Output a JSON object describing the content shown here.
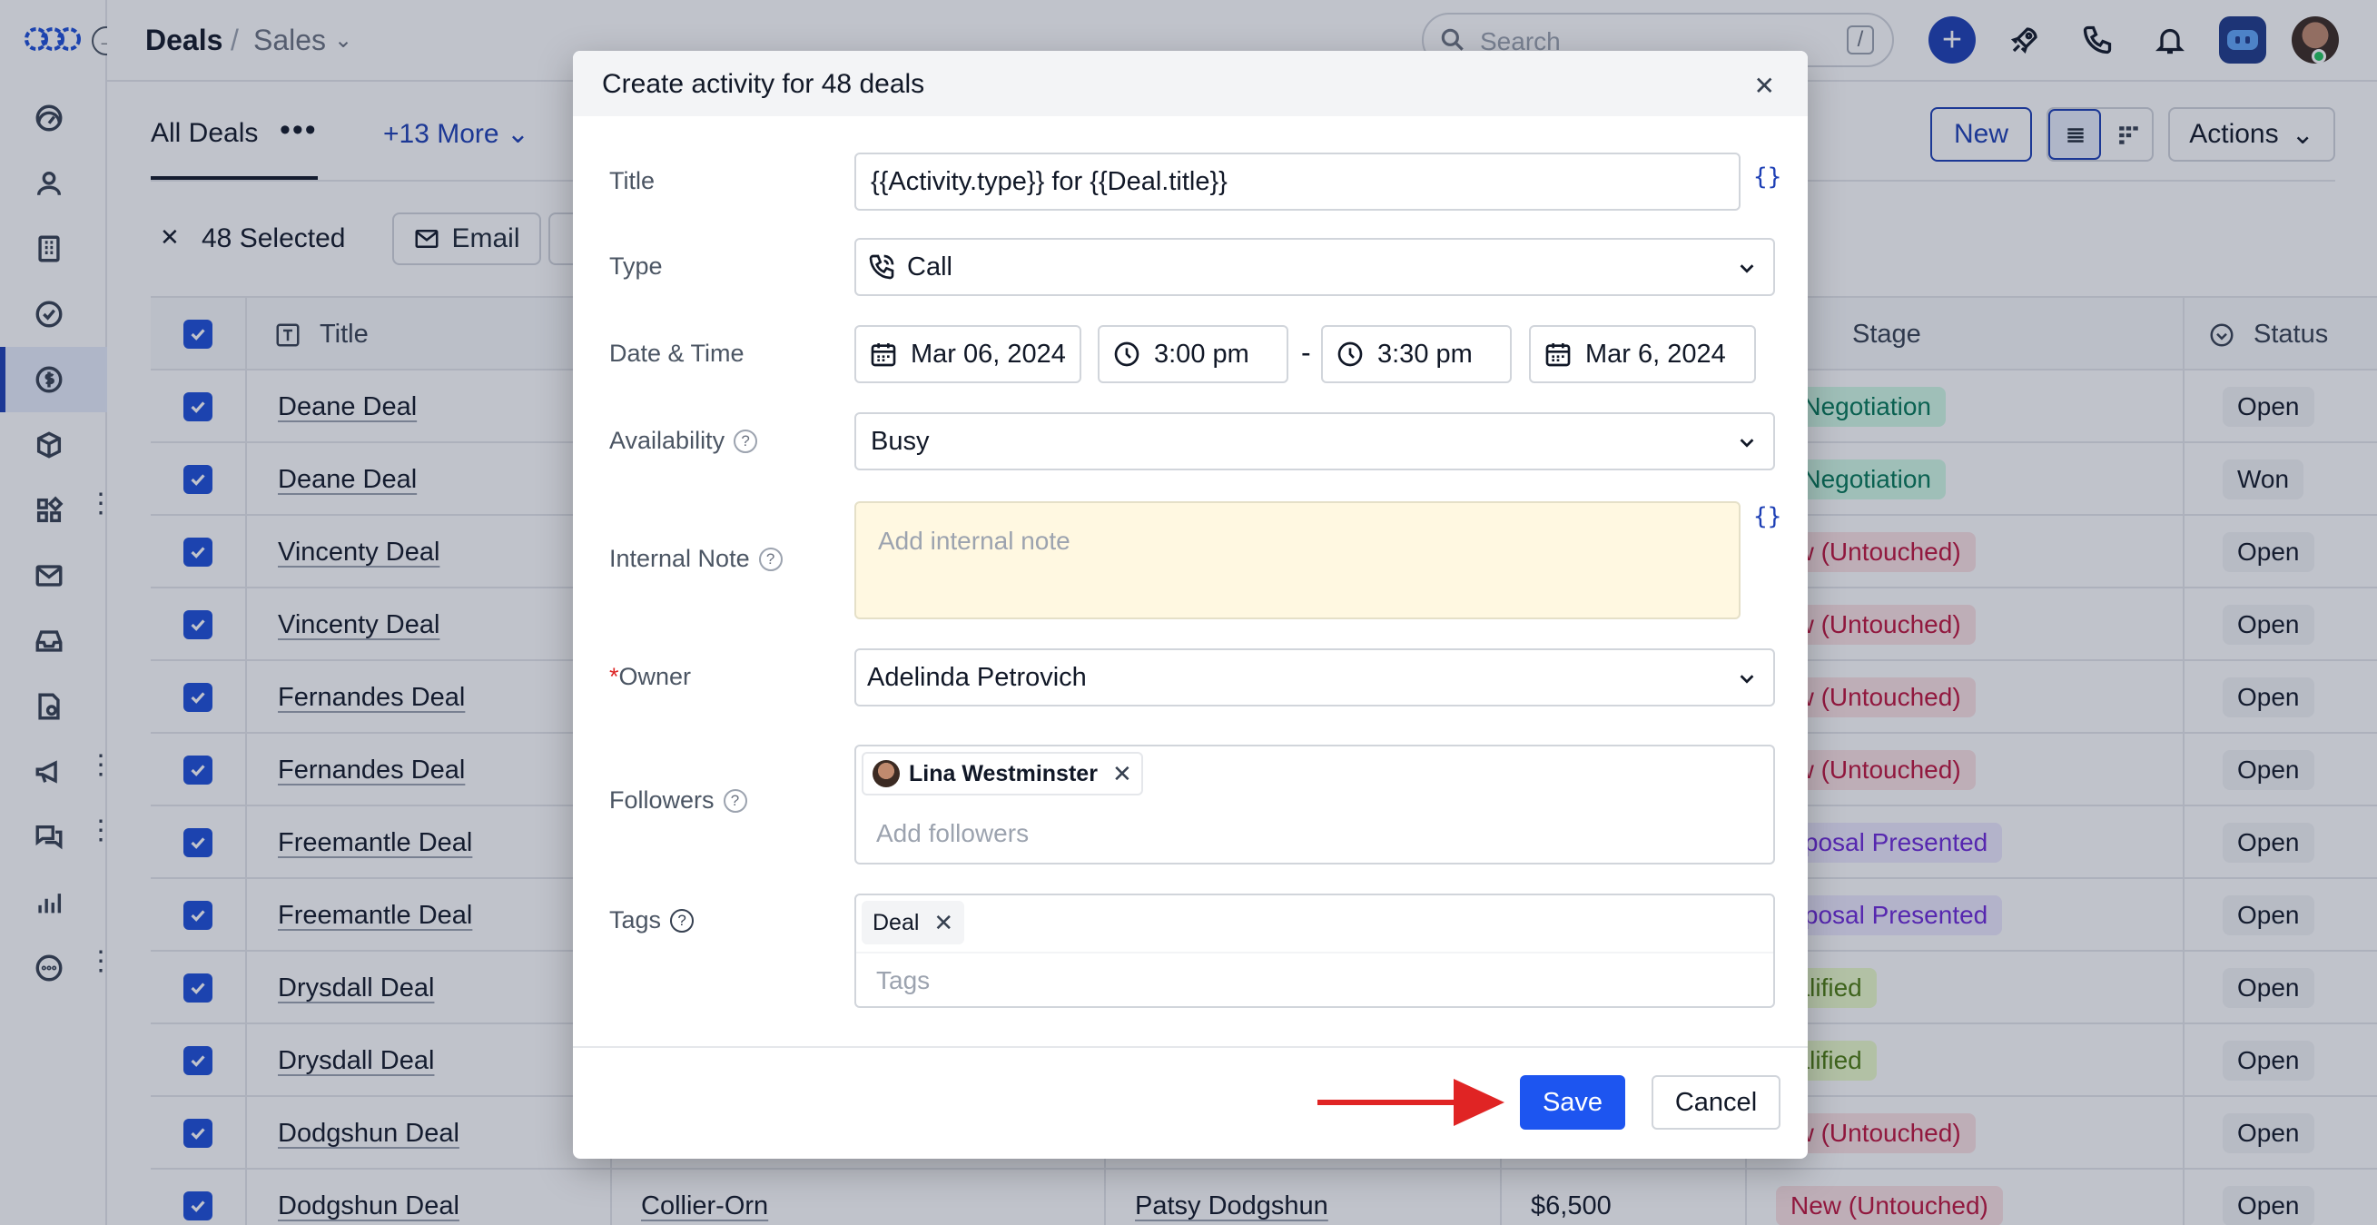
{
  "app": {
    "breadcrumb": {
      "root": "Deals",
      "separator": "/",
      "view": "Sales"
    },
    "search": {
      "placeholder": "Search",
      "shortcut": "/"
    },
    "tabs": {
      "active": "All Deals",
      "more": "+13 More"
    },
    "toolbar": {
      "new_label": "New",
      "actions_label": "Actions"
    },
    "selection": {
      "count_label": "48 Selected",
      "email_label": "Email"
    },
    "table": {
      "headers": {
        "title": "Title",
        "stage": "Stage",
        "status": "Status"
      },
      "rows": [
        {
          "title": "Deane Deal",
          "stage": "n Negotiation",
          "stage_color": "green",
          "status": "Open"
        },
        {
          "title": "Deane Deal",
          "stage": "n Negotiation",
          "stage_color": "green",
          "status": "Won"
        },
        {
          "title": "Vincenty Deal",
          "stage": "ew (Untouched)",
          "stage_color": "red",
          "status": "Open"
        },
        {
          "title": "Vincenty Deal",
          "stage": "ew (Untouched)",
          "stage_color": "red",
          "status": "Open"
        },
        {
          "title": "Fernandes Deal",
          "stage": "ew (Untouched)",
          "stage_color": "red",
          "status": "Open"
        },
        {
          "title": "Fernandes Deal",
          "stage": "ew (Untouched)",
          "stage_color": "red",
          "status": "Open"
        },
        {
          "title": "Freemantle Deal",
          "stage": "roposal Presented",
          "stage_color": "purple",
          "status": "Open"
        },
        {
          "title": "Freemantle Deal",
          "stage": "roposal Presented",
          "stage_color": "purple",
          "status": "Open"
        },
        {
          "title": "Drysdall Deal",
          "stage": "ualified",
          "stage_color": "lime",
          "status": "Open"
        },
        {
          "title": "Drysdall Deal",
          "stage": "ualified",
          "stage_color": "lime",
          "status": "Open"
        },
        {
          "title": "Dodgshun Deal",
          "stage": "ew (Untouched)",
          "stage_color": "red",
          "status": "Open"
        },
        {
          "title": "Dodgshun Deal",
          "company": "Collier-Orn",
          "contact": "Patsy Dodgshun",
          "value": "$6,500",
          "stage": "New (Untouched)",
          "stage_color": "red",
          "status": "Open"
        }
      ]
    }
  },
  "modal": {
    "title": "Create activity for 48 deals",
    "close_icon": "close-icon",
    "fields": {
      "title": {
        "label": "Title",
        "value": "{{Activity.type}} for {{Deal.title}}",
        "braces": "{}"
      },
      "type": {
        "label": "Type",
        "value": "Call"
      },
      "datetime": {
        "label": "Date & Time",
        "start_date": "Mar 06, 2024",
        "start_time": "3:00 pm",
        "separator": "-",
        "end_time": "3:30 pm",
        "end_date": "Mar 6, 2024"
      },
      "availability": {
        "label": "Availability",
        "value": "Busy",
        "help": "?"
      },
      "note": {
        "label": "Internal Note",
        "placeholder": "Add internal note",
        "braces": "{}",
        "help": "?"
      },
      "owner": {
        "label": "Owner",
        "required_mark": "*",
        "value": "Adelinda Petrovich"
      },
      "followers": {
        "label": "Followers",
        "chip": "Lina Westminster",
        "placeholder": "Add followers",
        "help": "?"
      },
      "tags": {
        "label": "Tags",
        "chip": "Deal",
        "placeholder": "Tags",
        "help": "?"
      }
    },
    "footer": {
      "save_label": "Save",
      "cancel_label": "Cancel"
    }
  },
  "colors": {
    "accent": "#1d3fb5",
    "save": "#1d55f0",
    "arrow": "#e02424",
    "note_bg": "#fff8e1"
  }
}
